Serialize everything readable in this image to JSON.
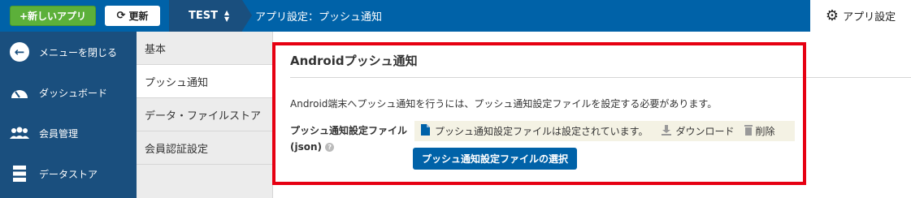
{
  "topbar": {
    "new_app_label": "+新しいアプリ",
    "refresh_label": "更新",
    "app_name": "TEST",
    "breadcrumb": "アプリ設定：プッシュ通知",
    "app_settings_label": "アプリ設定"
  },
  "sidebar": {
    "items": [
      {
        "label": "メニューを閉じる",
        "icon": "arrow-left-circle-icon"
      },
      {
        "label": "ダッシュボード",
        "icon": "gauge-icon"
      },
      {
        "label": "会員管理",
        "icon": "users-icon"
      },
      {
        "label": "データストア",
        "icon": "database-icon"
      }
    ]
  },
  "subnav": {
    "items": [
      {
        "label": "基本"
      },
      {
        "label": "プッシュ通知"
      },
      {
        "label": "データ・ファイルストア"
      },
      {
        "label": "会員認証設定"
      }
    ]
  },
  "main": {
    "title": "Androidプッシュ通知",
    "description": "Android端末へプッシュ通知を行うには、プッシュ通知設定ファイルを設定する必要があります。",
    "field_label": "プッシュ通知設定ファイル(json)",
    "file_status": "プッシュ通知設定ファイルは設定されています。",
    "download_label": "ダウンロード",
    "delete_label": "削除",
    "select_button_label": "プッシュ通知設定ファイルの選択"
  },
  "colors": {
    "topbar": "#0062a8",
    "sidebar": "#1a4f7e",
    "new_app_button": "#5cb03a",
    "highlight_border": "#e60012",
    "primary_button": "#0062a8"
  }
}
